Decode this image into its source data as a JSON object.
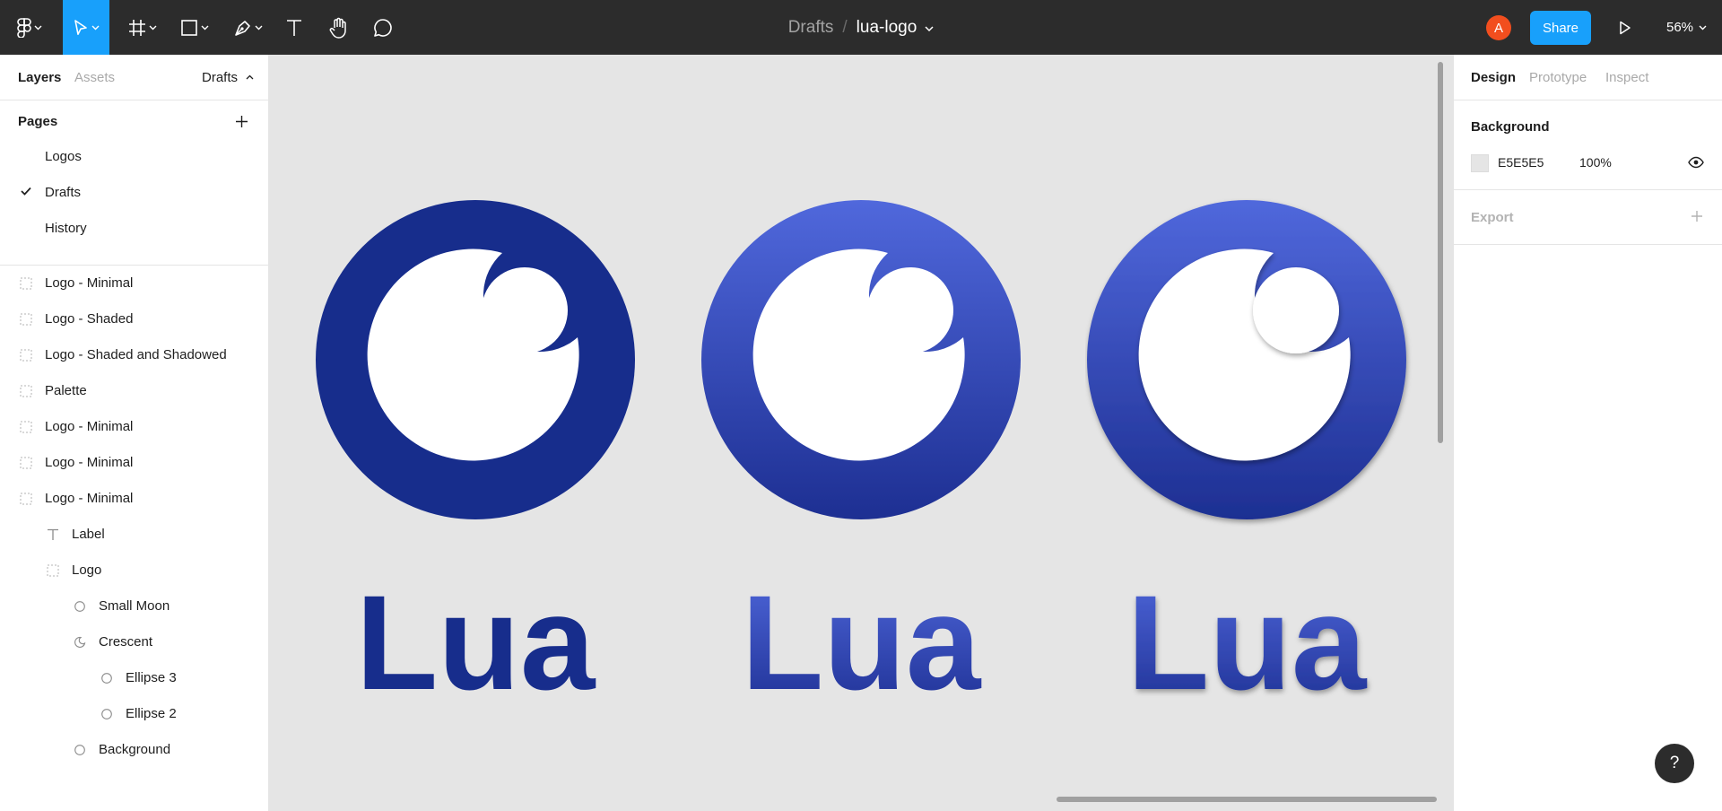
{
  "toolbar": {
    "breadcrumb_parent": "Drafts",
    "breadcrumb_separator": "/",
    "file_name": "lua-logo",
    "avatar_initial": "A",
    "share_label": "Share",
    "zoom_label": "56%",
    "tool_icons": [
      "figma-menu-icon",
      "move-tool-icon",
      "frame-tool-icon",
      "shape-tool-icon",
      "pen-tool-icon",
      "text-tool-icon",
      "hand-tool-icon",
      "comment-tool-icon"
    ],
    "accent_color": "#18a0fb"
  },
  "left_panel": {
    "tabs": {
      "layers": "Layers",
      "assets": "Assets",
      "drafts": "Drafts"
    },
    "pages_heading": "Pages",
    "pages": [
      {
        "label": "Logos",
        "selected": false
      },
      {
        "label": "Drafts",
        "selected": true
      },
      {
        "label": "History",
        "selected": false
      }
    ],
    "layers": [
      {
        "label": "Logo - Minimal",
        "icon": "frame-icon",
        "depth": 0
      },
      {
        "label": "Logo - Shaded",
        "icon": "frame-icon",
        "depth": 0
      },
      {
        "label": "Logo - Shaded and Shadowed",
        "icon": "frame-icon",
        "depth": 0
      },
      {
        "label": "Palette",
        "icon": "frame-icon",
        "depth": 0
      },
      {
        "label": "Logo - Minimal",
        "icon": "frame-icon",
        "depth": 0
      },
      {
        "label": "Logo - Minimal",
        "icon": "frame-icon",
        "depth": 0
      },
      {
        "label": "Logo - Minimal",
        "icon": "frame-icon",
        "depth": 0
      },
      {
        "label": "Label",
        "icon": "text-icon",
        "depth": 1
      },
      {
        "label": "Logo",
        "icon": "frame-icon",
        "depth": 1
      },
      {
        "label": "Small Moon",
        "icon": "ellipse-icon",
        "depth": 2
      },
      {
        "label": "Crescent",
        "icon": "boolean-icon",
        "depth": 2
      },
      {
        "label": "Ellipse 3",
        "icon": "ellipse-icon",
        "depth": 3
      },
      {
        "label": "Ellipse 2",
        "icon": "ellipse-icon",
        "depth": 3
      },
      {
        "label": "Background",
        "icon": "ellipse-icon",
        "depth": 2
      }
    ]
  },
  "canvas": {
    "background_color": "#e5e5e5",
    "logos": [
      {
        "variant": "minimal",
        "wordmark": "Lua",
        "fill_top": "#172d8c",
        "fill_bottom": "#172d8c",
        "shadow": false
      },
      {
        "variant": "shaded",
        "wordmark": "Lua",
        "fill_top": "#5068dc",
        "fill_bottom": "#1d2f92",
        "shadow": false
      },
      {
        "variant": "shaded-shadowed",
        "wordmark": "Lua",
        "fill_top": "#5068dc",
        "fill_bottom": "#1d2f92",
        "shadow": true
      }
    ]
  },
  "right_panel": {
    "tabs": {
      "design": "Design",
      "prototype": "Prototype",
      "inspect": "Inspect"
    },
    "background_heading": "Background",
    "background_hex": "E5E5E5",
    "background_opacity": "100%",
    "background_color": "#e5e5e5",
    "export_heading": "Export"
  },
  "help_label": "?"
}
